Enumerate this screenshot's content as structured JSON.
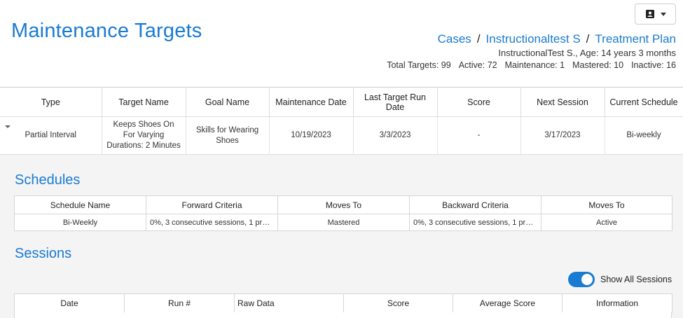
{
  "header": {
    "title": "Maintenance Targets",
    "user_menu_icon": "id-badge-icon"
  },
  "breadcrumb": {
    "items": [
      "Cases",
      "Instructionaltest S",
      "Treatment Plan"
    ],
    "separator": "/"
  },
  "patient_info": "InstructionalTest S., Age: 14 years 3 months",
  "target_stats": {
    "total": "Total Targets: 99",
    "active": "Active: 72",
    "maintenance": "Maintenance: 1",
    "mastered": "Mastered: 10",
    "inactive": "Inactive: 16"
  },
  "targets_table": {
    "columns": [
      "Type",
      "Target Name",
      "Goal Name",
      "Maintenance Date",
      "Last Target Run Date",
      "Score",
      "Next Session",
      "Current Schedule"
    ],
    "rows": [
      {
        "type": "Partial Interval",
        "target_name": "Keeps Shoes On For Varying Durations: 2 Minutes",
        "goal_name": "Skills for Wearing Shoes",
        "maintenance_date": "10/19/2023",
        "last_run_date": "3/3/2023",
        "score": "-",
        "next_session": "3/17/2023",
        "current_schedule": "Bi-weekly"
      }
    ]
  },
  "schedules": {
    "title": "Schedules",
    "columns": [
      "Schedule Name",
      "Forward Criteria",
      "Moves To",
      "Backward Criteria",
      "Moves To"
    ],
    "rows": [
      {
        "name": "Bi-Weekly",
        "forward": "0%, 3 consecutive sessions, 1 pro…",
        "forward_moves_to": "Mastered",
        "backward": "0%, 3 consecutive sessions, 1 pro…",
        "backward_moves_to": "Active"
      }
    ]
  },
  "sessions": {
    "title": "Sessions",
    "toggle_label": "Show All Sessions",
    "toggle_on": true,
    "columns": [
      "Date",
      "Run #",
      "Raw Data",
      "Score",
      "Average Score",
      "Information"
    ]
  },
  "colors": {
    "accent": "#1a7bd2",
    "panel_bg": "#f4f4f4"
  }
}
